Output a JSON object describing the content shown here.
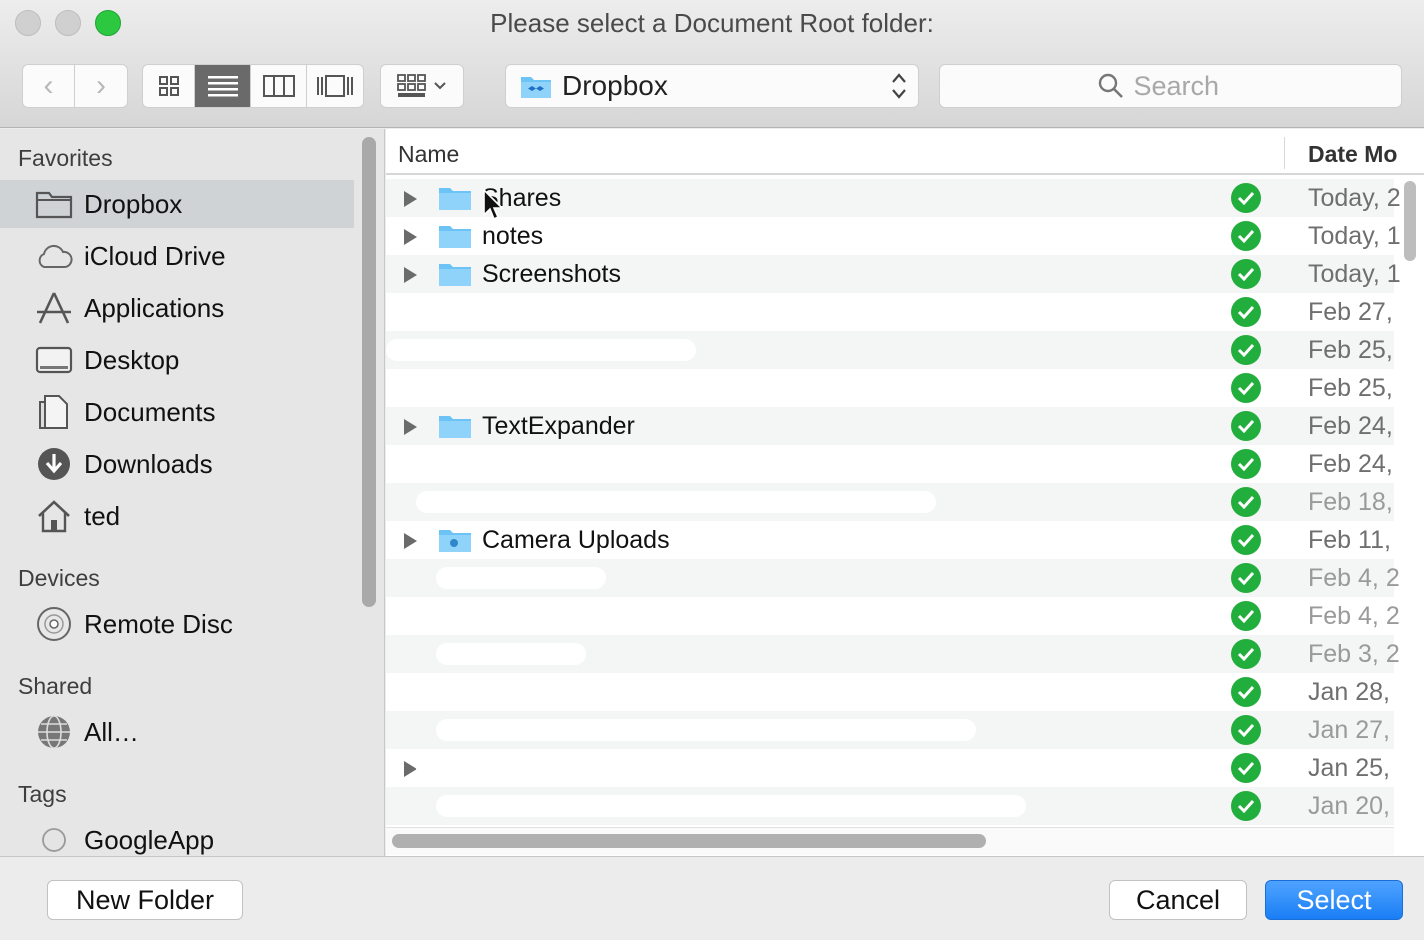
{
  "window": {
    "title": "Please select a Document Root folder:"
  },
  "toolbar": {
    "back_label": "‹",
    "forward_label": "›",
    "path_location": "Dropbox",
    "search_placeholder": "Search"
  },
  "sidebar": {
    "sections": {
      "favorites": "Favorites",
      "devices": "Devices",
      "shared": "Shared",
      "tags": "Tags"
    },
    "favorites": [
      {
        "label": "Dropbox",
        "icon": "folder-icon",
        "selected": true
      },
      {
        "label": "iCloud Drive",
        "icon": "cloud-icon"
      },
      {
        "label": "Applications",
        "icon": "applications-icon"
      },
      {
        "label": "Desktop",
        "icon": "desktop-icon"
      },
      {
        "label": "Documents",
        "icon": "documents-icon"
      },
      {
        "label": "Downloads",
        "icon": "downloads-icon"
      },
      {
        "label": "ted",
        "icon": "home-icon"
      }
    ],
    "devices": [
      {
        "label": "Remote Disc",
        "icon": "disc-icon"
      }
    ],
    "shared": [
      {
        "label": "All…",
        "icon": "network-icon"
      }
    ],
    "tags": [
      {
        "label": "GoogleApp",
        "icon": "tag-circle-icon"
      }
    ]
  },
  "list": {
    "columns": {
      "name": "Name",
      "date": "Date Mo"
    },
    "rows": [
      {
        "name": "Shares",
        "date": "Today, 2",
        "folder": true,
        "expand": true
      },
      {
        "name": "notes",
        "date": "Today, 1",
        "folder": true,
        "expand": true
      },
      {
        "name": "Screenshots",
        "date": "Today, 1",
        "folder": true,
        "expand": true
      },
      {
        "name": "",
        "date": "Feb 27,",
        "folder": false,
        "expand": false
      },
      {
        "name": "",
        "date": "Feb 25,",
        "folder": false,
        "expand": false
      },
      {
        "name": "",
        "date": "Feb 25,",
        "folder": false,
        "expand": false
      },
      {
        "name": "TextExpander",
        "date": "Feb 24,",
        "folder": true,
        "expand": true
      },
      {
        "name": "",
        "date": "Feb 24,",
        "folder": false,
        "expand": false
      },
      {
        "name": "",
        "date": "Feb 18,",
        "folder": false,
        "expand": false,
        "dim": true
      },
      {
        "name": "Camera Uploads",
        "date": "Feb 11,",
        "folder": true,
        "expand": true,
        "camera": true
      },
      {
        "name": "",
        "date": "Feb 4, 2",
        "folder": false,
        "expand": false,
        "dim": true
      },
      {
        "name": "",
        "date": "Feb 4, 2",
        "folder": false,
        "expand": false,
        "dim": true
      },
      {
        "name": "",
        "date": "Feb 3, 2",
        "folder": false,
        "expand": false,
        "dim": true
      },
      {
        "name": "",
        "date": "Jan 28,",
        "folder": false,
        "expand": false
      },
      {
        "name": "",
        "date": "Jan 27,",
        "folder": false,
        "expand": false,
        "dim": true
      },
      {
        "name": "",
        "date": "Jan 25,",
        "folder": false,
        "expand": true
      },
      {
        "name": "",
        "date": "Jan 20,",
        "folder": false,
        "expand": false,
        "dim": true
      }
    ]
  },
  "footer": {
    "new_folder_label": "New Folder",
    "cancel_label": "Cancel",
    "select_label": "Select"
  },
  "colors": {
    "accent": "#1a7ef5",
    "sync_ok": "#22ae3c",
    "folder": "#6cc3f5"
  }
}
